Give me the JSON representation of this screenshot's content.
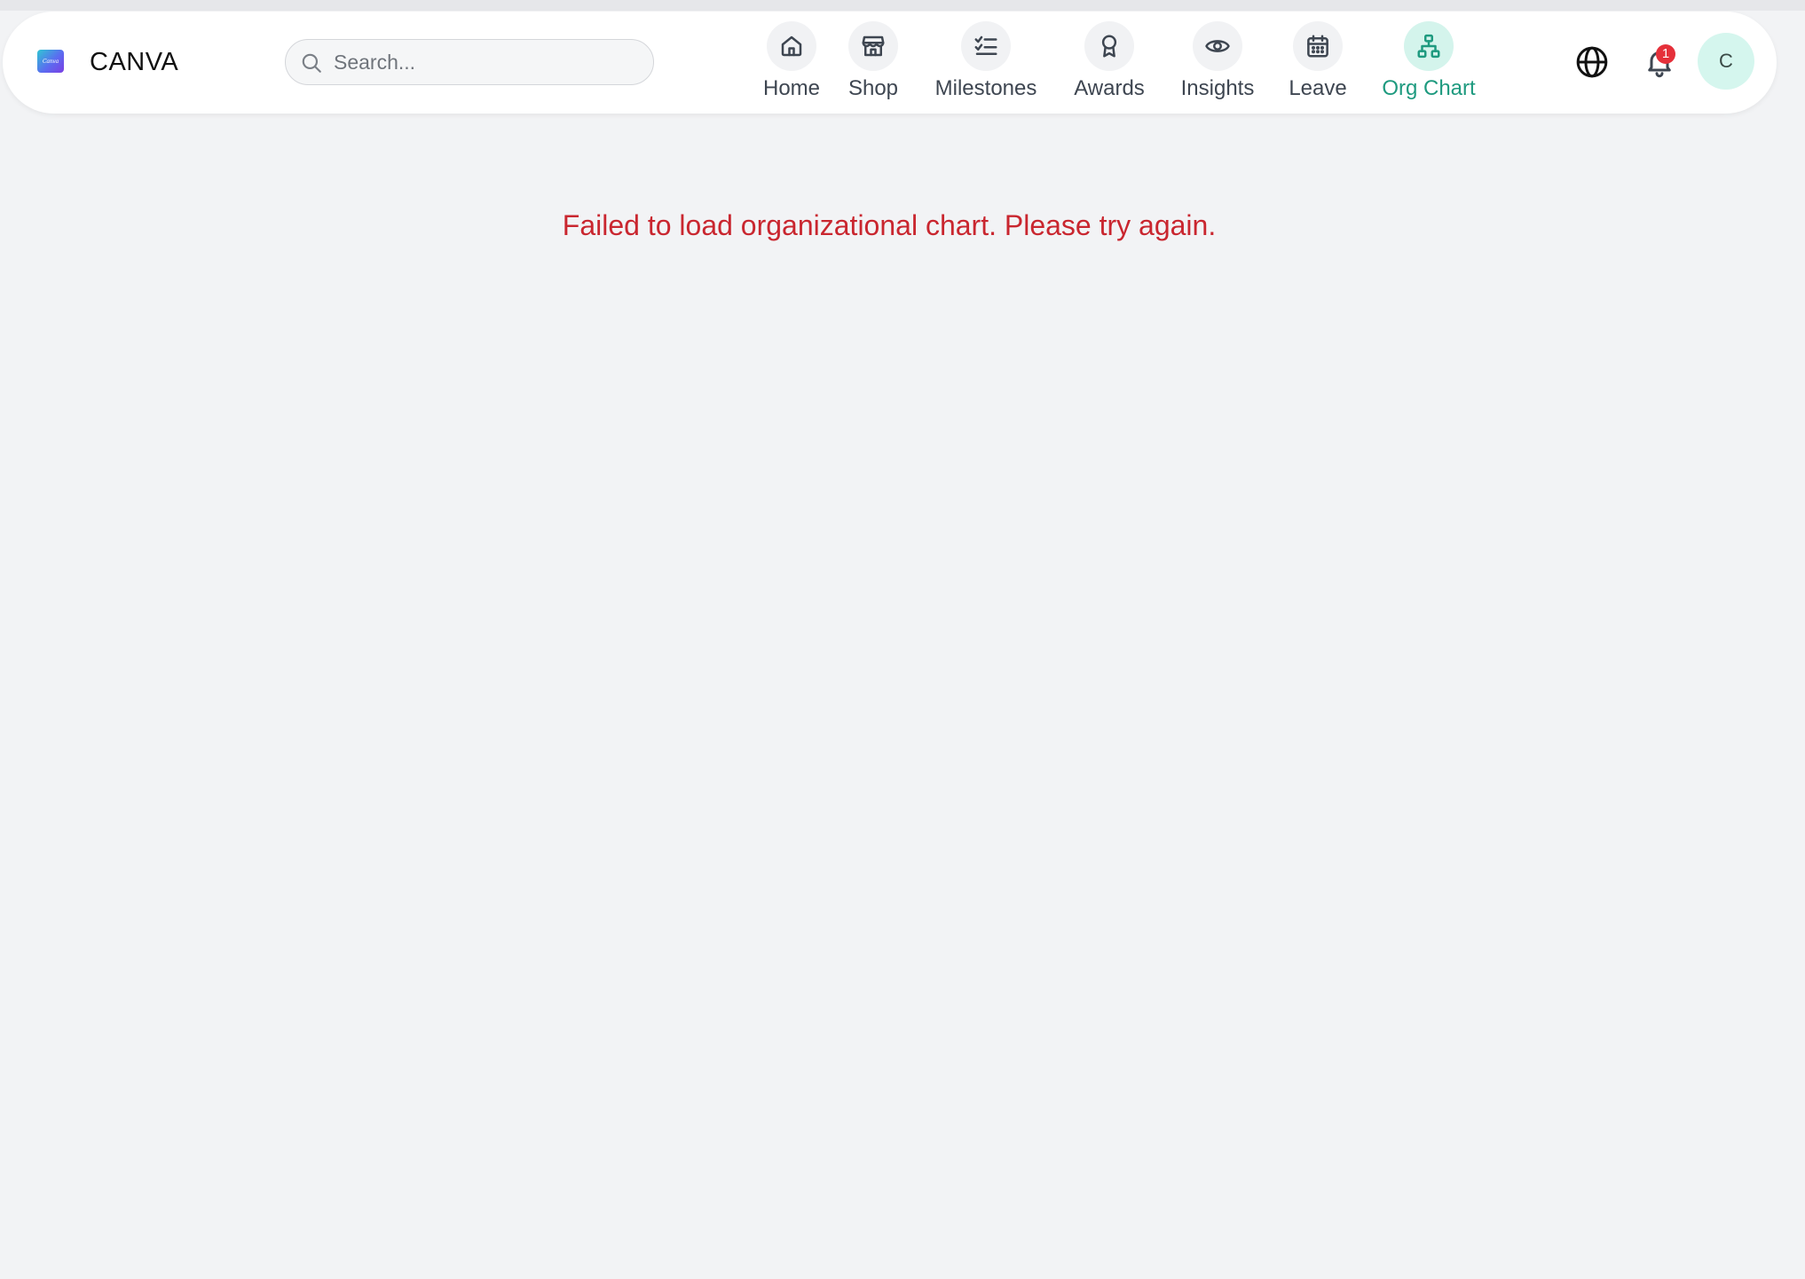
{
  "app": {
    "brand": "CANVA",
    "logo_text": "Canva"
  },
  "search": {
    "placeholder": "Search..."
  },
  "nav": {
    "items": [
      {
        "label": "Home",
        "icon": "home-icon"
      },
      {
        "label": "Shop",
        "icon": "store-icon"
      },
      {
        "label": "Milestones",
        "icon": "checklist-icon"
      },
      {
        "label": "Awards",
        "icon": "award-icon"
      },
      {
        "label": "Insights",
        "icon": "eye-icon"
      },
      {
        "label": "Leave",
        "icon": "calendar-icon"
      },
      {
        "label": "Org Chart",
        "icon": "org-chart-icon",
        "active": true
      }
    ]
  },
  "header": {
    "globe_icon": "globe-icon",
    "notifications": {
      "icon": "bell-icon",
      "count": "1"
    },
    "avatar_initial": "C"
  },
  "main": {
    "error_message": "Failed to load organizational chart. Please try again."
  },
  "colors": {
    "accent": "#1e9a7f",
    "error": "#c9262f",
    "badge": "#e5303a",
    "background": "#f2f3f5"
  }
}
